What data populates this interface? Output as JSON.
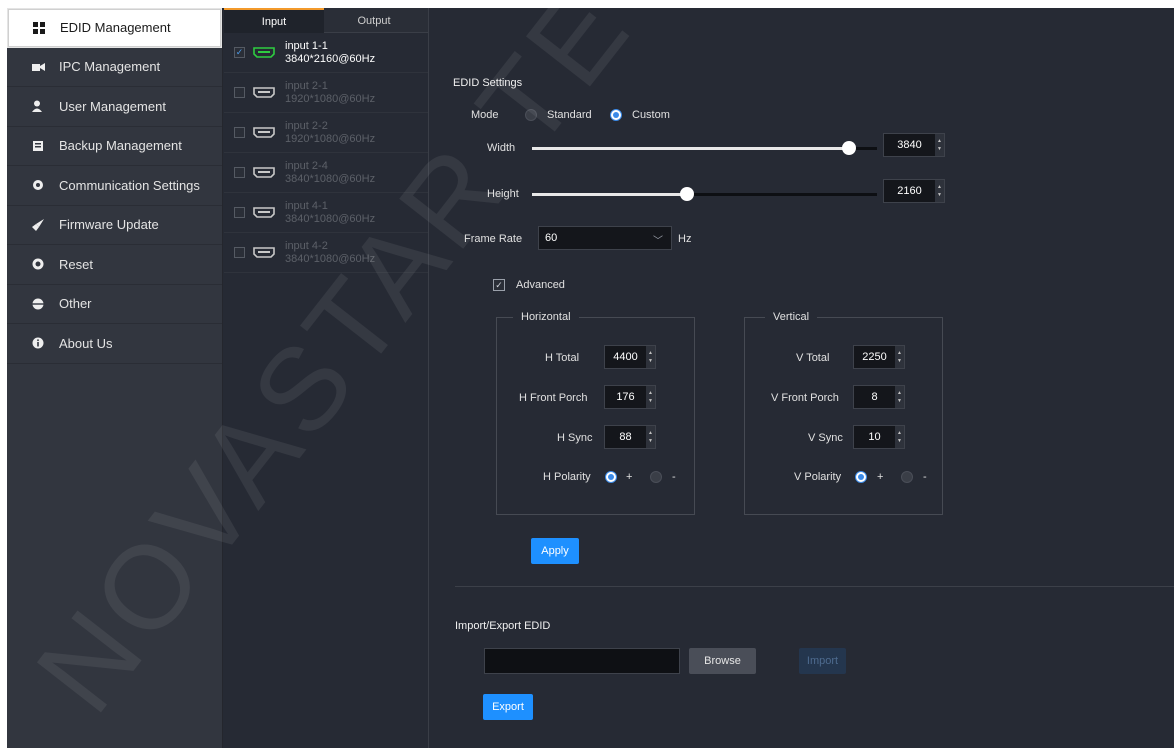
{
  "sidebar": {
    "items": [
      {
        "label": "EDID Management",
        "icon": "grid-icon"
      },
      {
        "label": "IPC Management",
        "icon": "camera-icon"
      },
      {
        "label": "User Management",
        "icon": "user-icon"
      },
      {
        "label": "Backup Management",
        "icon": "folder-icon"
      },
      {
        "label": "Communication Settings",
        "icon": "gear-icon"
      },
      {
        "label": "Firmware Update",
        "icon": "rocket-icon"
      },
      {
        "label": "Reset",
        "icon": "reset-icon"
      },
      {
        "label": "Other",
        "icon": "globe-icon"
      },
      {
        "label": "About Us",
        "icon": "info-icon"
      }
    ]
  },
  "tabs": {
    "input": "Input",
    "output": "Output"
  },
  "inputs": [
    {
      "name": "input 1-1",
      "res": "3840*2160@60Hz",
      "active": true
    },
    {
      "name": "input 2-1",
      "res": "1920*1080@60Hz",
      "active": false
    },
    {
      "name": "input 2-2",
      "res": "1920*1080@60Hz",
      "active": false
    },
    {
      "name": "input 2-4",
      "res": "3840*1080@60Hz",
      "active": false
    },
    {
      "name": "input 4-1",
      "res": "3840*1080@60Hz",
      "active": false
    },
    {
      "name": "input 4-2",
      "res": "3840*1080@60Hz",
      "active": false
    }
  ],
  "edid": {
    "title": "EDID Settings",
    "mode_label": "Mode",
    "mode_standard": "Standard",
    "mode_custom": "Custom",
    "mode_selected": "Custom",
    "width_label": "Width",
    "width_value": "3840",
    "width_fraction": 0.92,
    "height_label": "Height",
    "height_value": "2160",
    "height_fraction": 0.45,
    "frame_rate_label": "Frame Rate",
    "frame_rate_value": "60",
    "frame_rate_unit": "Hz",
    "advanced_label": "Advanced",
    "advanced_checked": true
  },
  "horizontal": {
    "legend": "Horizontal",
    "total_label": "H Total",
    "total_value": "4400",
    "front_porch_label": "H Front Porch",
    "front_porch_value": "176",
    "sync_label": "H Sync",
    "sync_value": "88",
    "polarity_label": "H Polarity",
    "pos": "+",
    "neg": "-",
    "polarity_selected": "+"
  },
  "vertical": {
    "legend": "Vertical",
    "total_label": "V Total",
    "total_value": "2250",
    "front_porch_label": "V Front Porch",
    "front_porch_value": "8",
    "sync_label": "V Sync",
    "sync_value": "10",
    "polarity_label": "V Polarity",
    "pos": "+",
    "neg": "-",
    "polarity_selected": "+"
  },
  "apply_label": "Apply",
  "import_export": {
    "title": "Import/Export EDID",
    "file_value": "",
    "browse_label": "Browse",
    "import_label": "Import",
    "export_label": "Export"
  },
  "colors": {
    "accent": "#1e90ff",
    "tab_indicator": "#f39a2b",
    "port_active": "#2ecc40"
  },
  "watermark": "NOVASTAR TECH"
}
